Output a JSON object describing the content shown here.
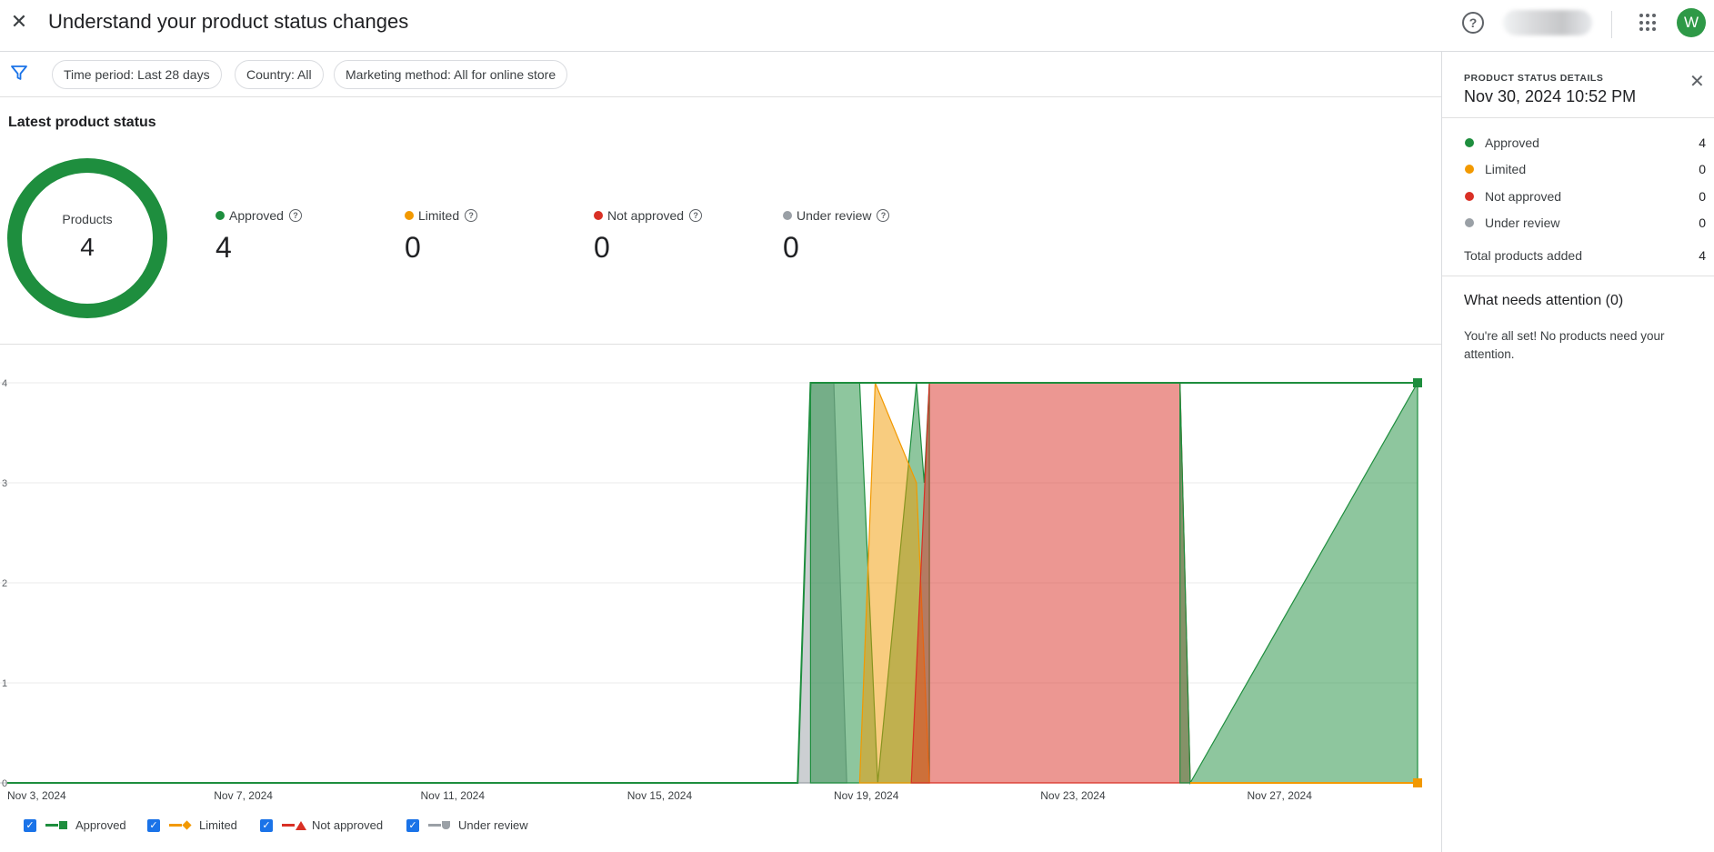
{
  "header": {
    "close_icon": "close-icon",
    "title": "Understand your product status changes",
    "help_icon": "help-icon",
    "apps_icon": "apps-grid-icon",
    "avatar_letter": "W"
  },
  "filters": {
    "filter_icon": "filter-icon",
    "chips": [
      {
        "label": "Time period: Last 28 days"
      },
      {
        "label": "Country: All"
      },
      {
        "label": "Marketing method: All for online store"
      }
    ]
  },
  "summary": {
    "title": "Latest product status",
    "donut_label": "Products",
    "donut_value": "4",
    "stats": [
      {
        "label": "Approved",
        "value": "4",
        "color": "#1e8e3e"
      },
      {
        "label": "Limited",
        "value": "0",
        "color": "#f29900"
      },
      {
        "label": "Not approved",
        "value": "0",
        "color": "#d93025"
      },
      {
        "label": "Under review",
        "value": "0",
        "color": "#9aa0a6"
      }
    ]
  },
  "chart_data": {
    "type": "area",
    "x": [
      "Nov 3, 2024",
      "Nov 7, 2024",
      "Nov 11, 2024",
      "Nov 15, 2024",
      "Nov 19, 2024",
      "Nov 23, 2024",
      "Nov 27, 2024"
    ],
    "xlabels": [
      "Nov 3, 2024",
      "Nov 7, 2024",
      "Nov 11, 2024",
      "Nov 15, 2024",
      "Nov 19, 2024",
      "Nov 23, 2024",
      "Nov 27, 2024"
    ],
    "yticks": [
      "0",
      "1",
      "2",
      "3",
      "4"
    ],
    "ylim": [
      0,
      4
    ],
    "xlim_days": [
      0,
      27.3
    ],
    "grid": true,
    "legend_position": "bottom-left",
    "series": [
      {
        "name": "Under review",
        "color": "#9aa0a6",
        "x_days": [
          15.3,
          15.55,
          16.0,
          16.25
        ],
        "values": [
          0,
          4,
          4,
          0
        ]
      },
      {
        "name": "Approved",
        "color": "#1e8e3e",
        "x_days": [
          15.55,
          16.0,
          16.5,
          16.85,
          17.6,
          17.75,
          17.85
        ],
        "values": [
          4,
          4,
          4,
          0,
          4,
          3,
          4
        ]
      },
      {
        "name": "Limited",
        "color": "#f29900",
        "x_days": [
          16.5,
          16.8,
          17.6,
          17.85
        ],
        "values": [
          0,
          4,
          3,
          0
        ]
      },
      {
        "name": "Not approved",
        "color": "#d93025",
        "x_days": [
          17.5,
          17.85,
          22.7,
          22.9
        ],
        "values": [
          0,
          4,
          4,
          0
        ]
      },
      {
        "name": "Approved (latest)",
        "color": "#1e8e3e",
        "x_days": [
          22.7,
          22.9,
          27.3
        ],
        "values": [
          4,
          0,
          4
        ]
      }
    ],
    "current": {
      "Approved": 4,
      "Limited": 0,
      "Not approved": 0,
      "Under review": 0
    }
  },
  "legend": [
    {
      "label": "Approved",
      "color": "#1e8e3e",
      "shape": "square"
    },
    {
      "label": "Limited",
      "color": "#f29900",
      "shape": "diamond"
    },
    {
      "label": "Not approved",
      "color": "#d93025",
      "shape": "triangle"
    },
    {
      "label": "Under review",
      "color": "#9aa0a6",
      "shape": "rounded"
    }
  ],
  "panel": {
    "kicker": "PRODUCT STATUS DETAILS",
    "date": "Nov 30, 2024 10:52 PM",
    "rows": [
      {
        "label": "Approved",
        "count": "4",
        "color": "#1e8e3e"
      },
      {
        "label": "Limited",
        "count": "0",
        "color": "#f29900"
      },
      {
        "label": "Not approved",
        "count": "0",
        "color": "#d93025"
      },
      {
        "label": "Under review",
        "count": "0",
        "color": "#9aa0a6"
      }
    ],
    "total_label": "Total products added",
    "total_count": "4",
    "attention_title": "What needs attention (0)",
    "attention_body": "You're all set! No products need your attention."
  }
}
